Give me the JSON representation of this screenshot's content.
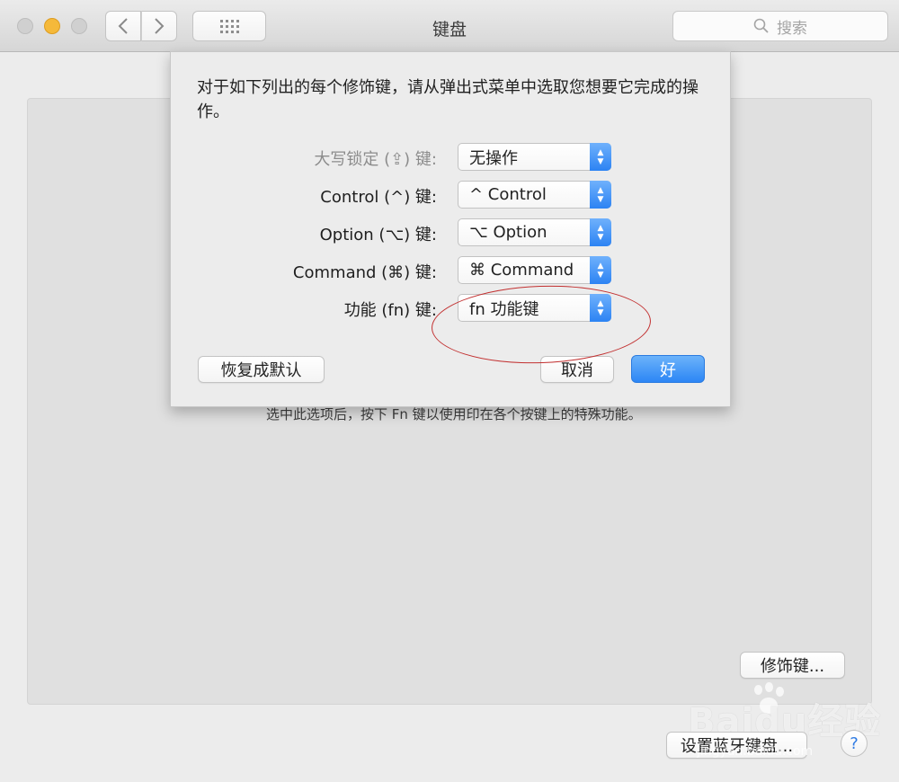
{
  "window": {
    "title": "键盘",
    "search_placeholder": "搜索"
  },
  "background": {
    "hint": "选中此选项后，按下 Fn 键以使用印在各个按键上的特殊功能。",
    "modifier_button": "修饰键...",
    "bluetooth_button": "设置蓝牙键盘...",
    "help_button": "?",
    "watermark": "Baidu经验",
    "watermark_sub": "jingyan.baidu.com"
  },
  "sheet": {
    "description": "对于如下列出的每个修饰键，请从弹出式菜单中选取您想要它完成的操作。",
    "rows": [
      {
        "label": "大写锁定 (⇪) 键:",
        "value": "无操作",
        "disabled": true
      },
      {
        "label": "Control (^) 键:",
        "value": "^ Control",
        "disabled": false
      },
      {
        "label": "Option (⌥) 键:",
        "value": "⌥ Option",
        "disabled": false
      },
      {
        "label": "Command (⌘) 键:",
        "value": "⌘ Command",
        "disabled": false
      },
      {
        "label": "功能 (fn) 键:",
        "value": "fn 功能键",
        "disabled": false
      }
    ],
    "restore_button": "恢复成默认",
    "cancel_button": "取消",
    "ok_button": "好"
  },
  "colors": {
    "accent": "#2c86f5",
    "annotation": "#c23030"
  }
}
